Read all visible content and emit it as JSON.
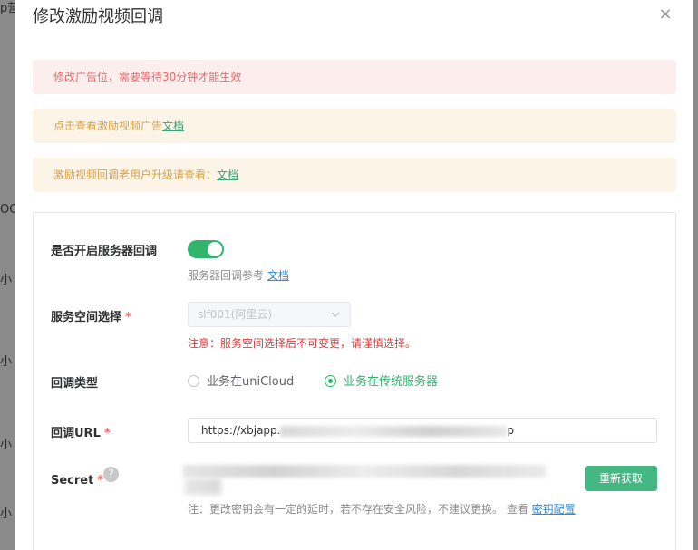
{
  "dialog": {
    "title": "修改激励视频回调",
    "close_icon": "×"
  },
  "alerts": {
    "error_text": "修改广告位，需要等待30分钟才能生效",
    "warn1_text": "点击查看激励视频广告",
    "warn1_link": "文档",
    "warn2_text": "激励视频回调老用户升级请查看：",
    "warn2_link": "文档"
  },
  "form": {
    "server_callback": {
      "label": "是否开启服务器回调",
      "enabled": true,
      "hint_text": "服务器回调参考",
      "hint_link": "文档"
    },
    "space": {
      "label": "服务空间选择",
      "required_mark": "*",
      "selected": "slf001(阿里云)",
      "warning": "注意：服务空间选择后不可变更，请谨慎选择。"
    },
    "callback_type": {
      "label": "回调类型",
      "options": [
        "业务在uniCloud",
        "业务在传统服务器"
      ],
      "selected": "业务在传统服务器"
    },
    "callback_url": {
      "label": "回调URL",
      "required_mark": "*",
      "value_prefix": "https://xbjapp.",
      "value_suffix": "p"
    },
    "secret": {
      "label": "Secret",
      "required_mark": "*",
      "help_icon": "?",
      "refresh_button": "重新获取",
      "note_text": "注：更改密钥会有一定的延时，若不存在安全风险，不建议更换。 查看",
      "note_link": "密钥配置"
    }
  },
  "background": {
    "fragments": [
      "p营",
      "OCI",
      "小",
      "小",
      "小",
      "小"
    ]
  },
  "colors": {
    "accent_green": "#2fb56c",
    "error_red": "#e23c3c",
    "link_blue": "#2d8ad6"
  }
}
